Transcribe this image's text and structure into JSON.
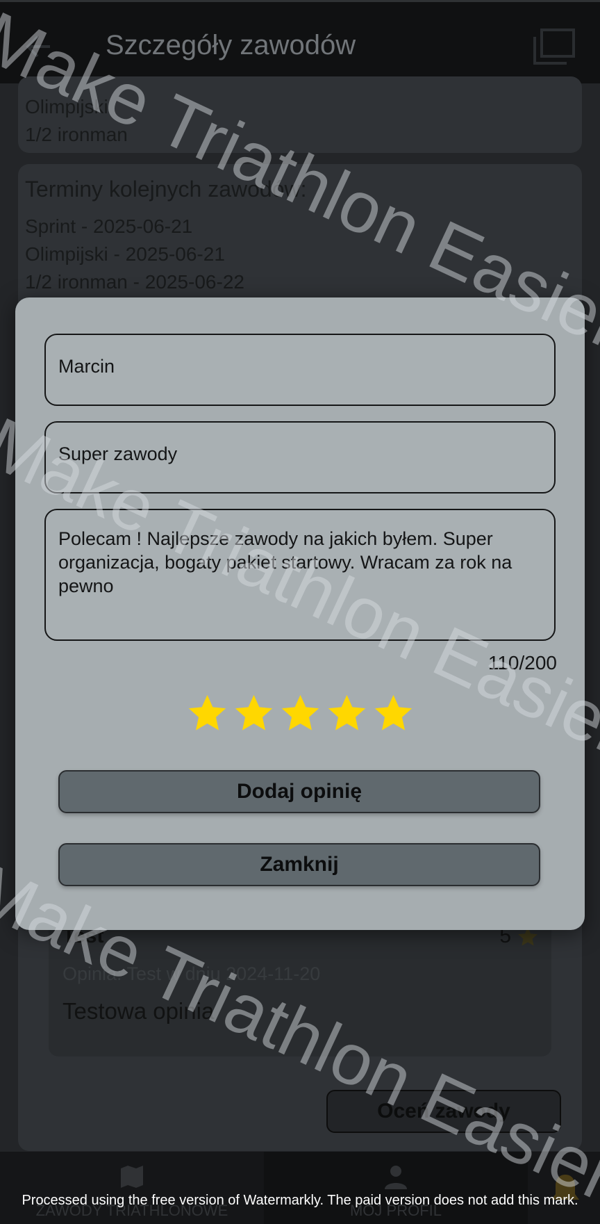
{
  "header": {
    "title": "Szczegóły zawodów"
  },
  "distances": {
    "items": [
      "Olimpijski",
      "1/2 ironman"
    ]
  },
  "schedule": {
    "title": "Terminy kolejnych zawodów:",
    "items": [
      "Sprint - 2025-06-21",
      "Olimpijski - 2025-06-21",
      "1/2 ironman - 2025-06-22"
    ]
  },
  "review": {
    "author": "Test",
    "score": "5",
    "meta": "Opinia: Test w dniu 2024-11-20",
    "text": "Testowa opinia"
  },
  "rate_button_label": "Oceń zawody",
  "bottom_nav": [
    {
      "label": "ZAWODY TRIATHLONOWE",
      "icon": "map-icon"
    },
    {
      "label": "MÓJ PROFIL",
      "icon": "person-icon"
    }
  ],
  "dialog": {
    "name_value": "Marcin",
    "title_value": "Super zawody",
    "body_value": "Polecam ! Najlepsze zawody na jakich byłem. Super organizacja, bogaty pakiet startowy. Wracam za rok na pewno",
    "counter": "110/200",
    "rating": 5,
    "rating_max": 5,
    "add_label": "Dodaj opinię",
    "close_label": "Zamknij"
  },
  "watermark": {
    "text": "Make Triathlon Easier",
    "notice": "Processed using the free version of Watermarkly. The paid version does not add this mark."
  },
  "colors": {
    "star": "#ffd700",
    "dialog_bg": "#a6adb0",
    "button_bg": "#60696e"
  }
}
